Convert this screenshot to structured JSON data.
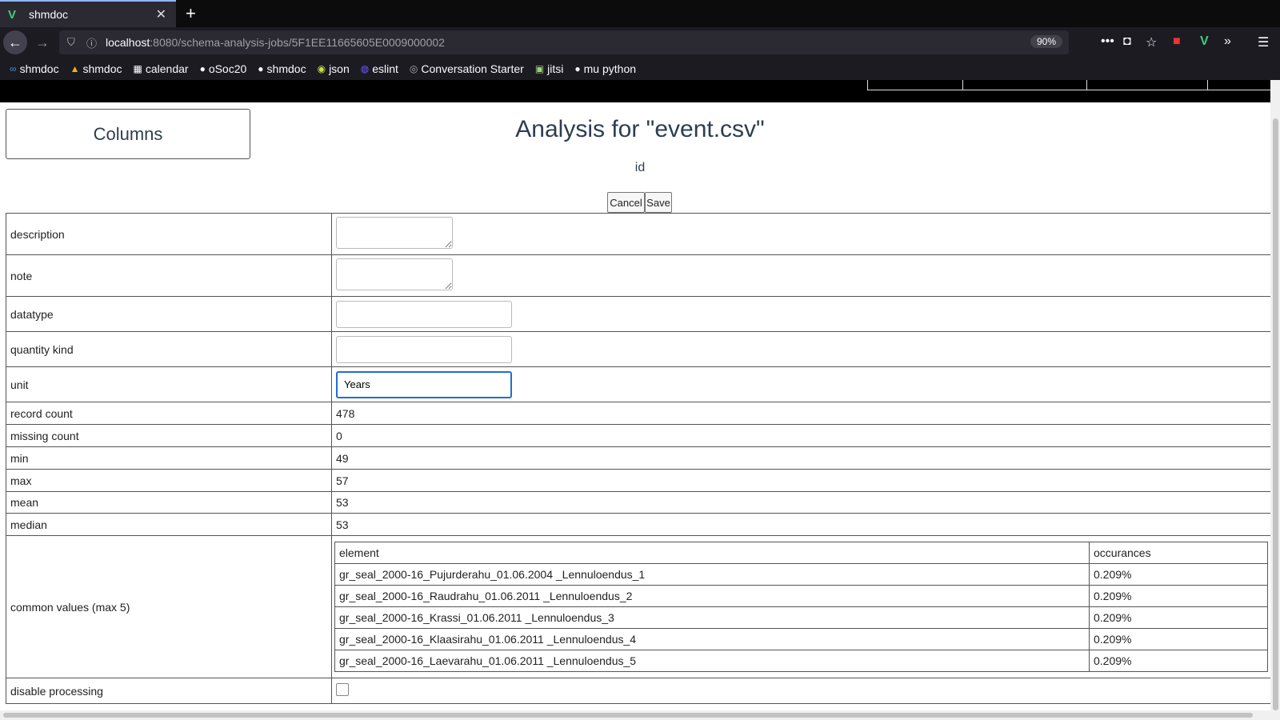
{
  "browser": {
    "tab_title": "shmdoc",
    "favicon": "V",
    "close_label": "✕",
    "newtab_label": "+",
    "url_host": "localhost",
    "url_path": ":8080/schema-analysis-jobs/5F1EE11665605E0009000002",
    "zoom": "90%",
    "bookmarks": [
      {
        "label": "shmdoc",
        "icon": "link-icon"
      },
      {
        "label": "shmdoc",
        "icon": "drive-icon"
      },
      {
        "label": "calendar",
        "icon": "calendar-icon"
      },
      {
        "label": "oSoc20",
        "icon": "github-icon"
      },
      {
        "label": "shmdoc",
        "icon": "github-icon"
      },
      {
        "label": "json",
        "icon": "json-icon"
      },
      {
        "label": "eslint",
        "icon": "eslint-icon"
      },
      {
        "label": "Conversation Starter",
        "icon": "globe-icon"
      },
      {
        "label": "jitsi",
        "icon": "jitsi-icon"
      },
      {
        "label": "mu python",
        "icon": "github-icon"
      }
    ]
  },
  "page": {
    "columns_button": "Columns",
    "title": "Analysis for \"event.csv\"",
    "column_name": "id",
    "cancel_label": "Cancel",
    "save_label": "Save"
  },
  "fields": {
    "description_label": "description",
    "note_label": "note",
    "datatype_label": "datatype",
    "quantity_kind_label": "quantity kind",
    "unit_label": "unit",
    "unit_value": "Years",
    "record_count_label": "record count",
    "record_count": "478",
    "missing_count_label": "missing count",
    "missing_count": "0",
    "min_label": "min",
    "min": "49",
    "max_label": "max",
    "max": "57",
    "mean_label": "mean",
    "mean": "53",
    "median_label": "median",
    "median": "53",
    "common_values_label": "common values (max 5)",
    "disable_processing_label": "disable processing",
    "disable_processing_checked": false
  },
  "common_values": {
    "headers": [
      "element",
      "occurances"
    ],
    "rows": [
      [
        "gr_seal_2000-16_Pujurderahu_01.06.2004 _Lennuloendus_1",
        "0.209%"
      ],
      [
        "gr_seal_2000-16_Raudrahu_01.06.2011 _Lennuloendus_2",
        "0.209%"
      ],
      [
        "gr_seal_2000-16_Krassi_01.06.2011 _Lennuloendus_3",
        "0.209%"
      ],
      [
        "gr_seal_2000-16_Klaasirahu_01.06.2011 _Lennuloendus_4",
        "0.209%"
      ],
      [
        "gr_seal_2000-16_Laevarahu_01.06.2011 _Lennuloendus_5",
        "0.209%"
      ]
    ]
  }
}
